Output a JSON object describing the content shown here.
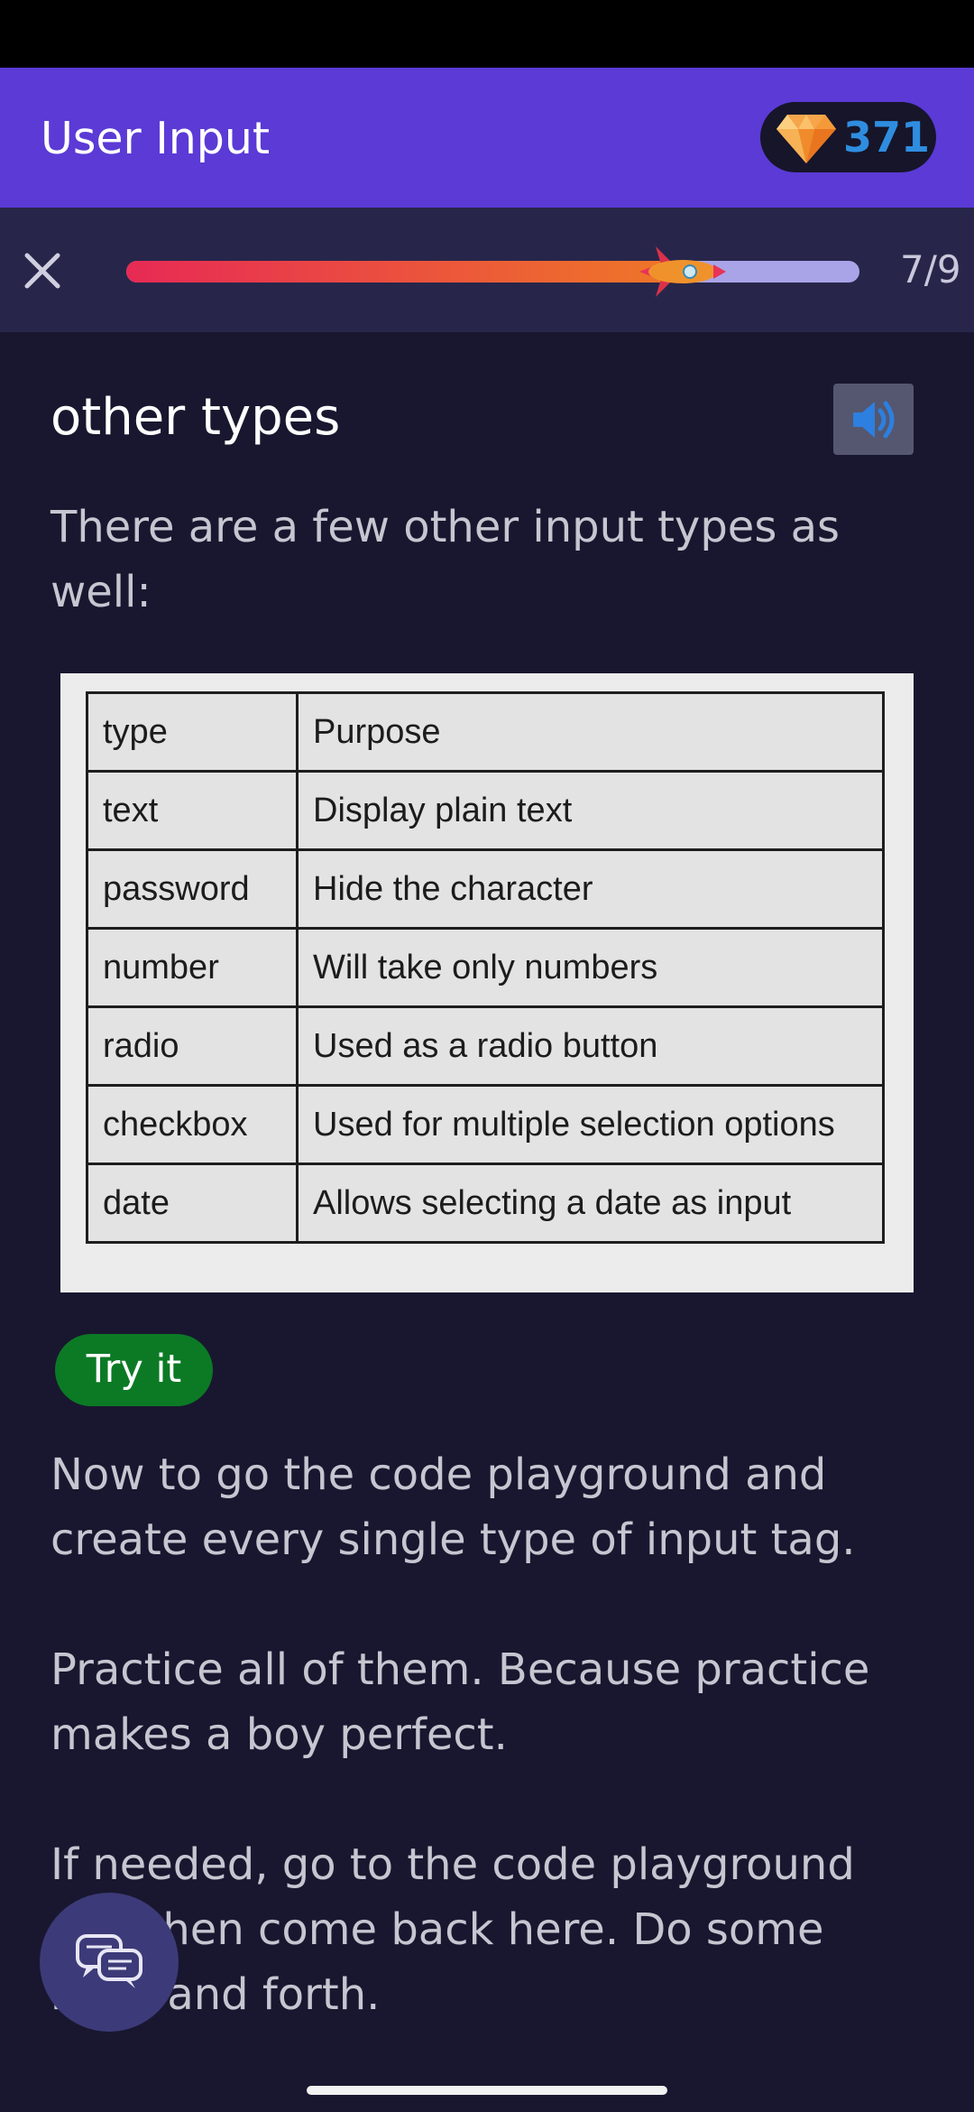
{
  "app": {
    "title": "User Input",
    "gem_count": "371"
  },
  "progress": {
    "value": 0.78,
    "step_label": "7/9"
  },
  "lesson": {
    "heading": "other types",
    "intro": "There are a few other input types as well:",
    "table": {
      "header": [
        "type",
        "Purpose"
      ],
      "rows": [
        [
          "text",
          "Display plain text"
        ],
        [
          "password",
          "Hide the character"
        ],
        [
          "number",
          "Will take only numbers"
        ],
        [
          "radio",
          "Used as a radio button"
        ],
        [
          "checkbox",
          "Used for multiple selection options"
        ],
        [
          "date",
          "Allows selecting a date as input"
        ]
      ]
    },
    "try_it_label": "Try it",
    "para1": "Now to go the code playground and create every single type of input tag.",
    "para2": "Practice all of them. Because practice makes a boy perfect.",
    "para3": "If needed, go to the code playground and then come back here. Do some back and forth."
  },
  "icons": {
    "close": "close-icon",
    "gem": "gem-icon",
    "rocket": "rocket-icon",
    "speaker": "speaker-icon",
    "chat": "chat-icon"
  },
  "colors": {
    "appbar": "#5b3ad6",
    "background": "#19172f",
    "accent_blue": "#2f8de0",
    "try_it": "#0c7a25"
  }
}
